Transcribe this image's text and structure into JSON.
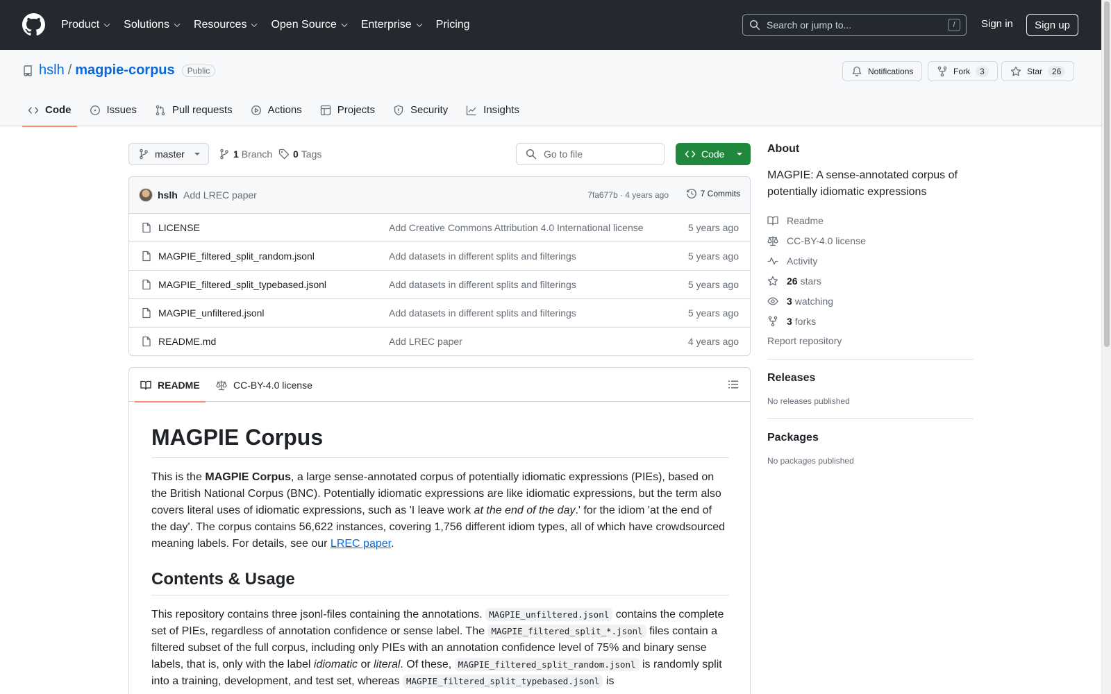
{
  "header": {
    "nav": [
      {
        "label": "Product",
        "has_menu": true
      },
      {
        "label": "Solutions",
        "has_menu": true
      },
      {
        "label": "Resources",
        "has_menu": true
      },
      {
        "label": "Open Source",
        "has_menu": true
      },
      {
        "label": "Enterprise",
        "has_menu": true
      },
      {
        "label": "Pricing",
        "has_menu": false
      }
    ],
    "search_placeholder": "Search or jump to...",
    "search_shortcut": "/",
    "sign_in": "Sign in",
    "sign_up": "Sign up"
  },
  "repo": {
    "owner": "hslh",
    "separator": "/",
    "name": "magpie-corpus",
    "visibility": "Public",
    "notifications_label": "Notifications",
    "fork_label": "Fork",
    "fork_count": "3",
    "star_label": "Star",
    "star_count": "26",
    "tabs": [
      {
        "label": "Code",
        "icon": "code-icon",
        "selected": true
      },
      {
        "label": "Issues",
        "icon": "issue-icon",
        "selected": false
      },
      {
        "label": "Pull requests",
        "icon": "pull-request-icon",
        "selected": false
      },
      {
        "label": "Actions",
        "icon": "play-icon",
        "selected": false
      },
      {
        "label": "Projects",
        "icon": "table-icon",
        "selected": false
      },
      {
        "label": "Security",
        "icon": "shield-icon",
        "selected": false
      },
      {
        "label": "Insights",
        "icon": "graph-icon",
        "selected": false
      }
    ]
  },
  "toolbar": {
    "branch": "master",
    "branch_count": "1",
    "branch_label": "Branch",
    "tag_count": "0",
    "tag_label": "Tags",
    "goto_file_placeholder": "Go to file",
    "code_button": "Code"
  },
  "latest_commit": {
    "author": "hslh",
    "message": "Add LREC paper",
    "hash_and_age": "7fa677b · 4 years ago",
    "commits_label": "7 Commits"
  },
  "files": [
    {
      "name": "LICENSE",
      "message": "Add Creative Commons Attribution 4.0 International license",
      "age": "5 years ago"
    },
    {
      "name": "MAGPIE_filtered_split_random.jsonl",
      "message": "Add datasets in different splits and filterings",
      "age": "5 years ago"
    },
    {
      "name": "MAGPIE_filtered_split_typebased.jsonl",
      "message": "Add datasets in different splits and filterings",
      "age": "5 years ago"
    },
    {
      "name": "MAGPIE_unfiltered.jsonl",
      "message": "Add datasets in different splits and filterings",
      "age": "5 years ago"
    },
    {
      "name": "README.md",
      "message": "Add LREC paper",
      "age": "4 years ago"
    }
  ],
  "readme": {
    "tab_readme": "README",
    "tab_license": "CC-BY-4.0 license",
    "title": "MAGPIE Corpus",
    "p1": {
      "a": "This is the ",
      "b_bold": "MAGPIE Corpus",
      "c": ", a large sense-annotated corpus of potentially idiomatic expressions (PIEs), based on the British National Corpus (BNC). Potentially idiomatic expressions are like idiomatic expressions, but the term also covers literal uses of idiomatic expressions, such as 'I leave work ",
      "d_italic": "at the end of the day",
      "e": ".' for the idiom 'at the end of the day'. The corpus contains 56,622 instances, covering 1,756 different idiom types, all of which have crowdsourced meaning labels. For details, see our ",
      "f_link": "LREC paper",
      "g": "."
    },
    "h2": "Contents & Usage",
    "p2": {
      "a": "This repository contains three jsonl-files containing the annotations. ",
      "code1": "MAGPIE_unfiltered.jsonl",
      "b": " contains the complete set of PIEs, regardless of annotation confidence or sense label. The ",
      "code2": "MAGPIE_filtered_split_*.jsonl",
      "c": " files contain a filtered subset of the full corpus, including only PIEs with an annotation confidence level of 75% and binary sense labels, that is, only with the label ",
      "i1": "idiomatic",
      "d": " or ",
      "i2": "literal",
      "e": ". Of these, ",
      "code3": "MAGPIE_filtered_split_random.jsonl",
      "f": " is randomly split into a training, development, and test set, whereas ",
      "code4": "MAGPIE_filtered_split_typebased.jsonl",
      "g": " is"
    }
  },
  "sidebar": {
    "about_title": "About",
    "description": "MAGPIE: A sense-annotated corpus of potentially idiomatic expressions",
    "items": [
      {
        "icon": "book-icon",
        "label": "Readme",
        "bold": ""
      },
      {
        "icon": "law-icon",
        "label": "CC-BY-4.0 license",
        "bold": ""
      },
      {
        "icon": "pulse-icon",
        "label": "Activity",
        "bold": ""
      },
      {
        "icon": "star-icon",
        "label": "stars",
        "bold": "26"
      },
      {
        "icon": "eye-icon",
        "label": "watching",
        "bold": "3"
      },
      {
        "icon": "fork-icon",
        "label": "forks",
        "bold": "3"
      }
    ],
    "report": "Report repository",
    "releases_title": "Releases",
    "releases_text": "No releases published",
    "packages_title": "Packages",
    "packages_text": "No packages published"
  },
  "colors": {
    "header_bg": "#24292f",
    "link": "#0969da",
    "code_button": "#1f883d",
    "tab_underline": "#fd8c73"
  }
}
